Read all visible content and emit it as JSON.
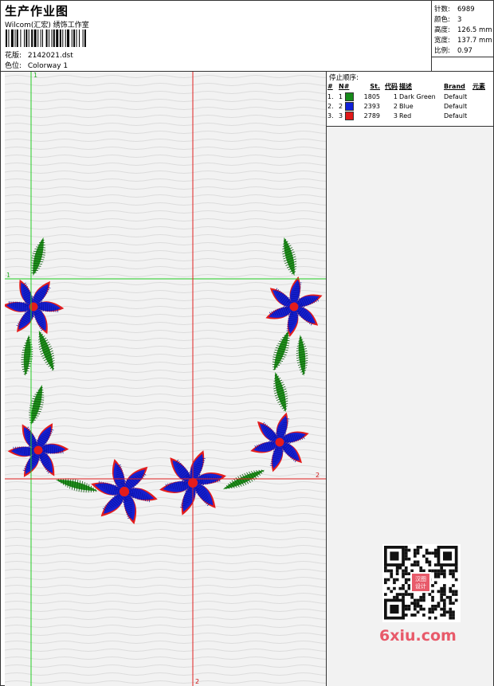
{
  "header": {
    "title": "生产作业图",
    "company": "Wilcom(汇宏) 绣饰工作室",
    "pattern_label": "花版:",
    "pattern_value": "2142021.dst",
    "colorway_label": "色位:",
    "colorway_value": "Colorway 1"
  },
  "stats": [
    {
      "label": "针数:",
      "value": "6989"
    },
    {
      "label": "颜色:",
      "value": "3"
    },
    {
      "label": "高度:",
      "value": "126.5 mm"
    },
    {
      "label": "宽度:",
      "value": "137.7 mm"
    },
    {
      "label": "比例:",
      "value": "0.97"
    }
  ],
  "stop_panel": {
    "title": "停止顺序:",
    "columns": [
      "#",
      "N#",
      "St.",
      "代码",
      "描述",
      "Brand",
      "元素"
    ],
    "rows": [
      {
        "idx": "1.",
        "n": "1",
        "st": "1805",
        "code": "1",
        "desc": "Dark Green",
        "brand": "Default",
        "color": "#168a1a"
      },
      {
        "idx": "2.",
        "n": "2",
        "st": "2393",
        "code": "2",
        "desc": "Blue",
        "brand": "Default",
        "color": "#1020d8"
      },
      {
        "idx": "3.",
        "n": "3",
        "st": "2789",
        "code": "3",
        "desc": "Red",
        "brand": "Default",
        "color": "#e01818"
      }
    ]
  },
  "guides": {
    "v1_label": "1",
    "h1_label": "1",
    "h2_label": "2",
    "v2_label": "2"
  },
  "colors": {
    "guide_green": "#22cc22",
    "guide_red": "#e02020",
    "leaf": "#20901c",
    "petal": "#1520d0",
    "outline": "#e41c1c"
  },
  "watermark": {
    "text": "6xiu.com",
    "badge": "汉图设计"
  }
}
